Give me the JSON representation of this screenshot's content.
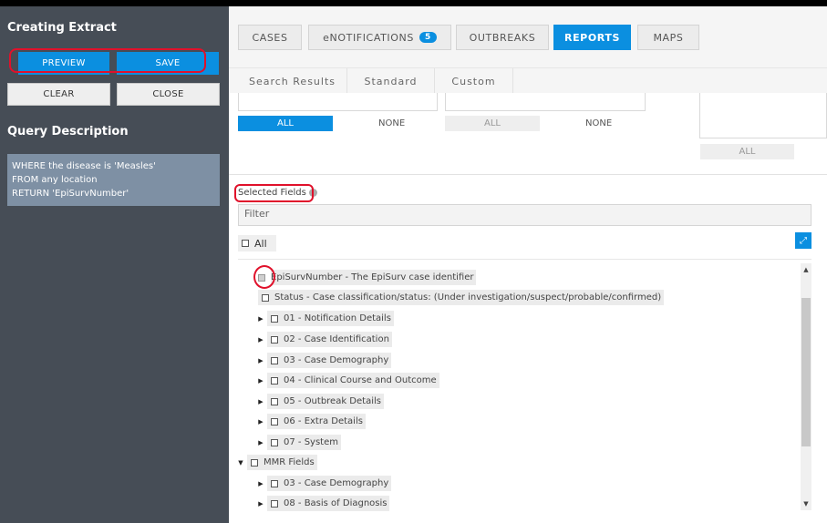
{
  "sidebar": {
    "title": "Creating Extract",
    "buttons": {
      "preview": "PREVIEW",
      "save": "SAVE",
      "clear": "CLEAR",
      "close": "CLOSE"
    },
    "query_title": "Query Description",
    "query_lines": [
      "WHERE the disease is 'Measles'",
      "FROM any location",
      "RETURN 'EpiSurvNumber'"
    ]
  },
  "tabs": [
    {
      "label": "CASES"
    },
    {
      "label": "eNOTIFICATIONS",
      "badge": "5"
    },
    {
      "label": "OUTBREAKS"
    },
    {
      "label": "REPORTS"
    },
    {
      "label": "MAPS"
    }
  ],
  "subtabs": [
    "Search Results",
    "Standard",
    "Custom"
  ],
  "selectors": {
    "all": "ALL",
    "none": "NONE"
  },
  "fields": {
    "label": "Selected Fields",
    "filter_placeholder": "Filter",
    "all_label": "All",
    "tree": [
      {
        "label": "EpiSurvNumber - The EpiSurv case identifier",
        "checked": true
      },
      {
        "label": "Status - Case classification/status: (Under investigation/suspect/probable/confirmed)"
      },
      {
        "label": "01 - Notification Details"
      },
      {
        "label": "02 - Case Identification"
      },
      {
        "label": "03 - Case Demography"
      },
      {
        "label": "04 - Clinical Course and Outcome"
      },
      {
        "label": "05 - Outbreak Details"
      },
      {
        "label": "06 - Extra Details"
      },
      {
        "label": "07 - System"
      },
      {
        "label": "MMR Fields"
      },
      {
        "label": "03 - Case Demography"
      },
      {
        "label": "08 - Basis of Diagnosis"
      }
    ]
  },
  "colors": {
    "accent": "#0b8fe0",
    "sidebar_bg": "#464d56",
    "highlight": "#e0112b"
  }
}
